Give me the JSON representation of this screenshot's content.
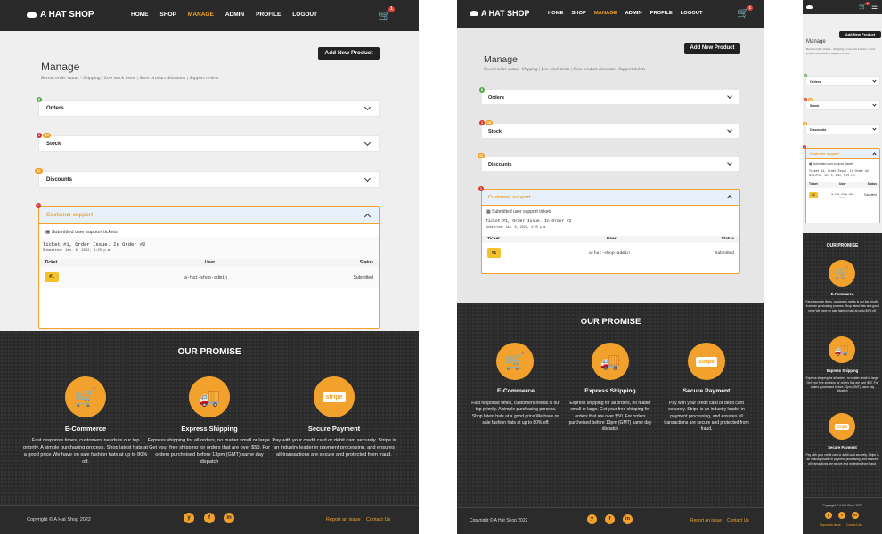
{
  "nav": {
    "brand": "A HAT SHOP",
    "links": [
      "HOME",
      "SHOP",
      "MANAGE",
      "ADMIN",
      "PROFILE",
      "LOGOUT"
    ],
    "active": "MANAGE",
    "cart_count": "1"
  },
  "manage": {
    "add_button": "Add New Product",
    "title": "Manage",
    "subtitle": "Recent order status - Shipping | Low stock items | Store product discounts | Support tickets",
    "sections": [
      {
        "label": "Orders",
        "badge": "0",
        "badge_color": "#5aa84a"
      },
      {
        "label": "Stock",
        "badge": "1",
        "badge2": "10",
        "badge_color": "#d9342b"
      },
      {
        "label": "Discounts",
        "badge": "11",
        "badge_color": "#f2a22c"
      },
      {
        "label": "Customer support",
        "badge": "1",
        "badge_color": "#d9342b"
      }
    ],
    "support": {
      "submitted_label": "Submitted user support tickets",
      "ticket_line": "Ticket #1, Order Issue. In Order #2",
      "ticket_date": "Submitted: Jan. 6, 2022, 4:25 p.m.",
      "columns": [
        "Ticket",
        "User",
        "Status"
      ],
      "rows": [
        {
          "ticket": "#1",
          "user": "a-hat-shop-admin",
          "status": "Submitted"
        }
      ]
    }
  },
  "promise": {
    "heading": "OUR PROMISE",
    "features": [
      {
        "icon": "cart-icon",
        "title": "E-Commerce",
        "text": "Fast response times, customers needs is our top priority. A simple purchasing process. Shop latest hats at a good price We have on sale fashion hats at up to 80% off."
      },
      {
        "icon": "truck-icon",
        "title": "Express Shipping",
        "text": "Express shipping for all orders, no matter small or large. Get your free shipping for orders that are over $50. For orders purcheised before 13pm (GMT) same day dispatch"
      },
      {
        "icon": "stripe-icon",
        "title": "Secure Payment",
        "text": "Pay with your credit card or debit card securely. Stripe is an industry leader in payment processing, and ensures all transactions are secure and protected from fraud."
      }
    ]
  },
  "footer": {
    "copyright": "Copyright © A Hat Shop 2022",
    "report": "Report an issue",
    "contact": "Contact Us",
    "social": [
      "y",
      "f",
      "in"
    ]
  },
  "colors": {
    "accent": "#f2a22c",
    "dark": "#2b2b2b"
  }
}
